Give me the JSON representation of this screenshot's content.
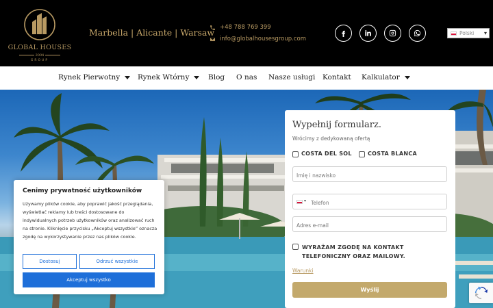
{
  "header": {
    "logo": {
      "name": "GLOBAL HOUSES",
      "year": "2004",
      "group": "GROUP"
    },
    "cities": "Marbella | Alicante | Warsaw",
    "phone": "+48 788 769 399",
    "email": "info@globalhousesgroup.com",
    "socials": [
      "facebook-icon",
      "linkedin-icon",
      "instagram-icon",
      "whatsapp-icon"
    ],
    "language": "Polski",
    "accent_color": "#b89a63"
  },
  "nav": {
    "items": [
      {
        "label": "Rynek Pierwotny",
        "dropdown": true
      },
      {
        "label": "Rynek Wtórny",
        "dropdown": true
      },
      {
        "label": "Blog",
        "dropdown": false
      },
      {
        "label": "O nas",
        "dropdown": false
      },
      {
        "label": "Nasze usługi",
        "dropdown": false
      },
      {
        "label": "Kontakt",
        "dropdown": false
      },
      {
        "label": "Kalkulator",
        "dropdown": true
      }
    ]
  },
  "cookie": {
    "title": "Cenimy prywatność użytkowników",
    "text": "Używamy plików cookie, aby poprawić jakość przeglądania, wyświetlać reklamy lub treści dostosowane do indywidualnych potrzeb użytkowników oraz analizować ruch na stronie. Kliknięcie przycisku „Akceptuj wszystkie” oznacza zgodę na wykorzystywanie przez nas plików cookie.",
    "settings_label": "Dostosuj",
    "reject_label": "Odrzuć wszystkie",
    "accept_label": "Akceptuj wszystko",
    "button_color": "#1e6fd9"
  },
  "form": {
    "title": "Wypełnij formularz.",
    "subtitle": "Wrócimy z dedykowaną ofertą",
    "region_options": [
      {
        "label": "COSTA DEL SOL",
        "checked": false
      },
      {
        "label": "COSTA BLANCA",
        "checked": false
      }
    ],
    "name_placeholder": "Imię i nazwisko",
    "phone_placeholder": "Telefon",
    "email_placeholder": "Adres e-mail",
    "consent_label": "WYRAŻAM ZGODĘ NA KONTAKT TELEFONICZNY ORAZ MAILOWY.",
    "consent_checked": false,
    "terms_link": "Warunki",
    "submit_label": "Wyślij",
    "submit_color": "#c3a96c"
  }
}
